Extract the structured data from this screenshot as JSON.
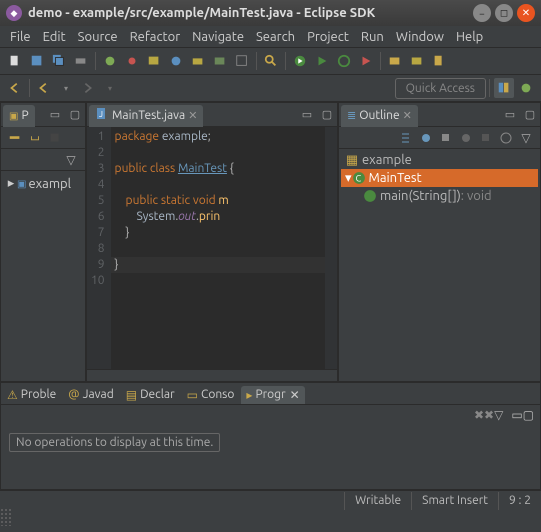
{
  "window": {
    "title": "demo - example/src/example/MainTest.java - Eclipse SDK"
  },
  "menu": [
    "File",
    "Edit",
    "Source",
    "Refactor",
    "Navigate",
    "Search",
    "Project",
    "Run",
    "Window",
    "Help"
  ],
  "quick_access": "Quick Access",
  "package_explorer": {
    "title": "P",
    "items": [
      {
        "label": "exampl"
      }
    ]
  },
  "editor": {
    "tab": "MainTest.java",
    "lines": [
      {
        "n": 1,
        "html": "<span class='kw'>package</span> <span class='id'>example</span>;"
      },
      {
        "n": 2,
        "html": ""
      },
      {
        "n": 3,
        "html": "<span class='kw'>public</span> <span class='kw'>class</span> <span class='ty'>MainTest</span> {"
      },
      {
        "n": 4,
        "html": ""
      },
      {
        "n": 5,
        "html": "    <span class='kw'>public</span> <span class='kw'>static</span> <span class='kw'>void</span> <span class='fn'>m</span>"
      },
      {
        "n": 6,
        "html": "        <span class='id'>System</span>.<span class='field'>out</span>.<span class='fn'>prin</span>"
      },
      {
        "n": 7,
        "html": "    }"
      },
      {
        "n": 8,
        "html": ""
      },
      {
        "n": 9,
        "html": "}"
      },
      {
        "n": 10,
        "html": ""
      }
    ]
  },
  "outline": {
    "title": "Outline",
    "rows": [
      {
        "label": "example",
        "kind": "pkg",
        "indent": 0
      },
      {
        "label": "MainTest",
        "kind": "class",
        "indent": 0,
        "selected": true
      },
      {
        "label": "main(String[])",
        "ret": " : void",
        "kind": "method",
        "indent": 1
      }
    ]
  },
  "bottom_tabs": [
    {
      "label": "Proble",
      "icon": "warn"
    },
    {
      "label": "Javad",
      "icon": "at"
    },
    {
      "label": "Declar",
      "icon": "decl"
    },
    {
      "label": "Conso",
      "icon": "cons"
    },
    {
      "label": "Progr",
      "icon": "prog",
      "active": true
    }
  ],
  "progress_msg": "No operations to display at this time.",
  "status": {
    "writable": "Writable",
    "insert": "Smart Insert",
    "pos": "9 : 2"
  }
}
